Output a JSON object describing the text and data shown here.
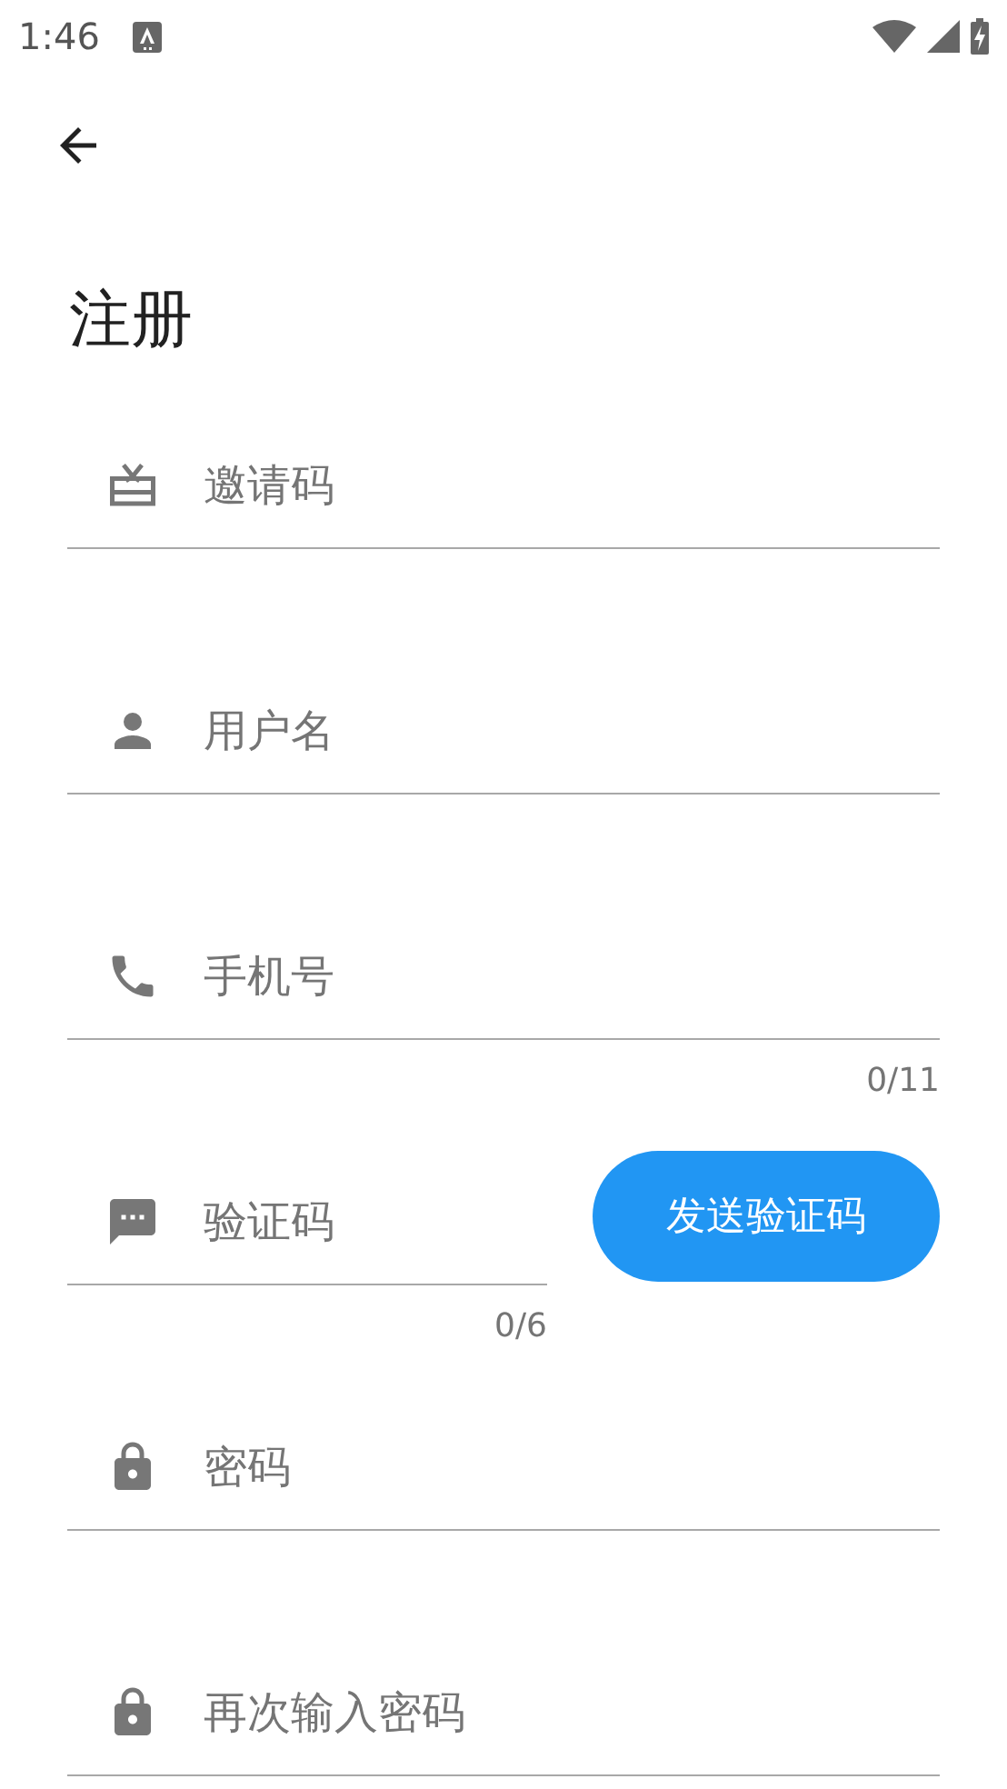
{
  "status_bar": {
    "time": "1:46"
  },
  "title": "注册",
  "fields": [
    {
      "kind": "gift",
      "placeholder": "邀请码"
    },
    {
      "kind": "person",
      "placeholder": "用户名"
    },
    {
      "kind": "phone",
      "placeholder": "手机号",
      "counter": "0/11"
    },
    {
      "kind": "message",
      "placeholder": "验证码",
      "counter": "0/6",
      "button": "发送验证码"
    },
    {
      "kind": "lock",
      "placeholder": "密码"
    },
    {
      "kind": "lock",
      "placeholder": "再次输入密码"
    }
  ]
}
